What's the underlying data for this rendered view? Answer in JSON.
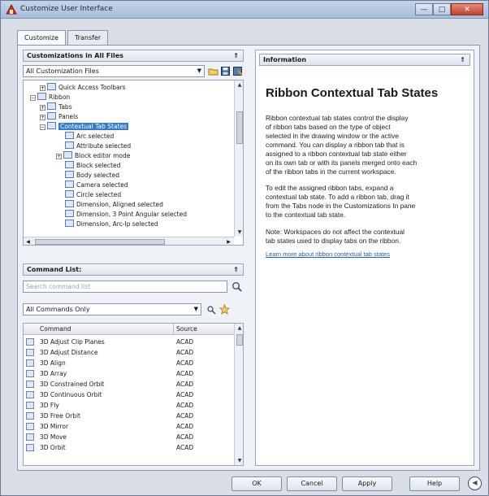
{
  "window": {
    "title": "Customize User Interface",
    "minimize": "—",
    "maximize": "□",
    "close": "✕"
  },
  "tabs": [
    {
      "label": "Customize"
    },
    {
      "label": "Transfer"
    }
  ],
  "customizations": {
    "header": "Customizations in All Files",
    "files_select": "All Customization Files",
    "tree": [
      {
        "label": "Quick Access Toolbars",
        "level": 2,
        "exp": "+"
      },
      {
        "label": "Ribbon",
        "level": 1,
        "exp": "−"
      },
      {
        "label": "Tabs",
        "level": 2,
        "exp": "+"
      },
      {
        "label": "Panels",
        "level": 2,
        "exp": "+"
      },
      {
        "label": "Contextual Tab States",
        "level": 2,
        "exp": "−",
        "selected": true
      },
      {
        "label": "Arc selected",
        "level": 3
      },
      {
        "label": "Attribute selected",
        "level": 3
      },
      {
        "label": "Block editor mode",
        "level": 3,
        "exp": "+"
      },
      {
        "label": "Block selected",
        "level": 3
      },
      {
        "label": "Body selected",
        "level": 3
      },
      {
        "label": "Camera selected",
        "level": 3
      },
      {
        "label": "Circle selected",
        "level": 3
      },
      {
        "label": "Dimension, Aligned selected",
        "level": 3
      },
      {
        "label": "Dimension, 3 Point Angular selected",
        "level": 3
      },
      {
        "label": "Dimension, Arc-Ip selected",
        "level": 3
      }
    ]
  },
  "command_list": {
    "header": "Command List:",
    "search_placeholder": "Search command list",
    "filter_select": "All Commands Only",
    "columns": {
      "command": "Command",
      "source": "Source"
    },
    "rows": [
      {
        "command": "3D Adjust Clip Planes",
        "source": "ACAD"
      },
      {
        "command": "3D Adjust Distance",
        "source": "ACAD"
      },
      {
        "command": "3D Align",
        "source": "ACAD"
      },
      {
        "command": "3D Array",
        "source": "ACAD"
      },
      {
        "command": "3D Constrained Orbit",
        "source": "ACAD"
      },
      {
        "command": "3D Continuous Orbit",
        "source": "ACAD"
      },
      {
        "command": "3D Fly",
        "source": "ACAD"
      },
      {
        "command": "3D Free Orbit",
        "source": "ACAD"
      },
      {
        "command": "3D Mirror",
        "source": "ACAD"
      },
      {
        "command": "3D Move",
        "source": "ACAD"
      },
      {
        "command": "3D Orbit",
        "source": "ACAD"
      }
    ]
  },
  "information": {
    "header": "Information",
    "title": "Ribbon Contextual Tab States",
    "p1": [
      "Ribbon contextual tab states control the display",
      "of ribbon tabs based on the type of object",
      "selected in the drawing window or the active",
      "command. You can display a ribbon tab that is",
      "assigned to a ribbon contextual tab state either",
      "on its own tab or with its panels merged onto each",
      "of the ribbon tabs in the current workspace."
    ],
    "p2": [
      "To edit the assigned ribbon tabs, expand a",
      "contextual tab state. To add a ribbon tab, drag it",
      "from the Tabs node in the Customizations In pane",
      "to the contextual tab state."
    ],
    "p3": [
      "Note: Workspaces do not affect the contextual",
      "tab states used to display tabs on the ribbon."
    ],
    "link": "Learn more about ribbon contextual tab states"
  },
  "buttons": {
    "ok": "OK",
    "cancel": "Cancel",
    "apply": "Apply",
    "help": "Help",
    "info_toggle": "◀"
  },
  "icons": {
    "collapse": "⇑",
    "save": "save-icon",
    "open": "open-folder-icon",
    "search": "search-icon",
    "new_command": "new-command-icon",
    "star": "star-icon"
  }
}
